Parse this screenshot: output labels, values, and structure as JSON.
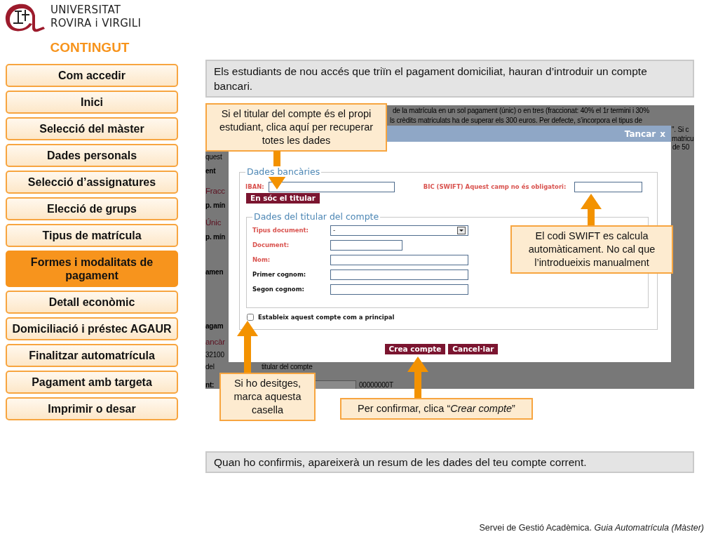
{
  "logo": {
    "lines": [
      "UNIVERSITAT",
      "ROVIRA i VIRGILI"
    ]
  },
  "sidebar": {
    "title": "CONTINGUT",
    "items": [
      {
        "label": "Com accedir",
        "selected": false
      },
      {
        "label": "Inici",
        "selected": false
      },
      {
        "label": "Selecció del màster",
        "selected": false
      },
      {
        "label": "Dades personals",
        "selected": false
      },
      {
        "label": "Selecció d’assignatures",
        "selected": false
      },
      {
        "label": "Elecció de grups",
        "selected": false
      },
      {
        "label": "Tipus de matrícula",
        "selected": false
      },
      {
        "label": "Formes i modalitats de pagament",
        "selected": true
      },
      {
        "label": "Detall econòmic",
        "selected": false
      },
      {
        "label": "Domiciliació i préstec AGAUR",
        "selected": false
      },
      {
        "label": "Finalitzar automatrícula",
        "selected": false
      },
      {
        "label": "Pagament amb targeta",
        "selected": false
      },
      {
        "label": "Imprimir o desar",
        "selected": false
      }
    ]
  },
  "intro": "Els estudiants de nou accés que triïn el pagament domiciliat, hauran d’introduir un compte bancari.",
  "screenshot": {
    "background_texts": [
      {
        "text": "de la matrícula en un sol pagament (únic) o en tres (fraccionat: 40% el 1r termini i 30%",
        "kind": "plain"
      },
      {
        "text": "ls crèdits matriculats ha de superar els 300 euros. Per defecte, s’incorpora el tipus de",
        "kind": "plain"
      },
      {
        "text": "\". Si c",
        "kind": "plain"
      },
      {
        "text": "matricu",
        "kind": "plain"
      },
      {
        "text": "quest",
        "kind": "plain"
      },
      {
        "text": "de 50",
        "kind": "plain"
      },
      {
        "text": "ent",
        "kind": "bold"
      },
      {
        "text": "Fracc",
        "kind": "red"
      },
      {
        "text": "p. mín",
        "kind": "bold"
      },
      {
        "text": "Únic",
        "kind": "red"
      },
      {
        "text": "p. mín",
        "kind": "bold"
      },
      {
        "text": "amen",
        "kind": "bold"
      },
      {
        "text": "agam",
        "kind": "bold"
      },
      {
        "text": "ancàr",
        "kind": "red"
      },
      {
        "text": "32100",
        "kind": "plain"
      },
      {
        "text": "del",
        "kind": "plain"
      },
      {
        "text": "titular del compte",
        "kind": "plain"
      },
      {
        "text": "nt:",
        "kind": "bold"
      },
      {
        "text": "00000000T",
        "kind": "plain"
      }
    ],
    "dialog": {
      "close_label": "Tancar",
      "close_icon": "x",
      "bank": {
        "legend": "Dades bancàries",
        "iban_label": "IBAN:",
        "bic_label": "BIC (SWIFT) Aquest camp no és obligatori:",
        "holder_button": "En sóc el titular"
      },
      "holder": {
        "legend": "Dades del titular del compte",
        "fields": [
          {
            "label": "Tipus document:",
            "kind": "select",
            "value": "-",
            "required": true
          },
          {
            "label": "Document:",
            "kind": "short",
            "required": true
          },
          {
            "label": "Nom:",
            "kind": "text",
            "required": true
          },
          {
            "label": "Primer cognom:",
            "kind": "text",
            "required": false
          },
          {
            "label": "Segon cognom:",
            "kind": "text",
            "required": false
          }
        ]
      },
      "checkbox": {
        "label": "Estableix aquest compte com a principal",
        "checked": false
      },
      "buttons": [
        "Crea compte",
        "Cancel·lar"
      ]
    }
  },
  "callouts": [
    {
      "text": "Si el titular del compte és el propi estudiant, clica aquí per recuperar totes les dades"
    },
    {
      "text": "El codi SWIFT es calcula automàticament. No cal que l’introdueixis manualment"
    },
    {
      "text": "Si ho desitges, marca aquesta casella"
    },
    {
      "text": "Per confirmar, clica “*Crear compte*”"
    }
  ],
  "summary": "Quan ho confirmis, apareixerà un resum de les dades del teu compte corrent.",
  "footer": "Servei de Gestió Acadèmica. *Guia Automatrícula (Màster)*"
}
